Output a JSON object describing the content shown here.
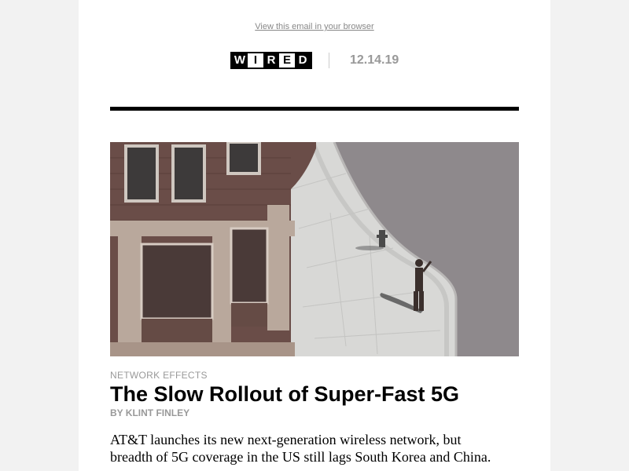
{
  "header": {
    "view_in_browser": "View this email in your browser",
    "logo_letters": [
      "W",
      "I",
      "R",
      "E",
      "D"
    ],
    "date": "12.14.19"
  },
  "article": {
    "kicker": "NETWORK EFFECTS",
    "headline": "The Slow Rollout of Super-Fast 5G",
    "byline": "BY KLINT FINLEY",
    "dek": "AT&T launches its new next-generation wireless network, but breadth of 5G coverage in the US still lags South Korea and China."
  },
  "colors": {
    "background": "#f2f2f2",
    "email_bg": "#ffffff",
    "rule": "#000000",
    "muted_text": "#999999"
  }
}
